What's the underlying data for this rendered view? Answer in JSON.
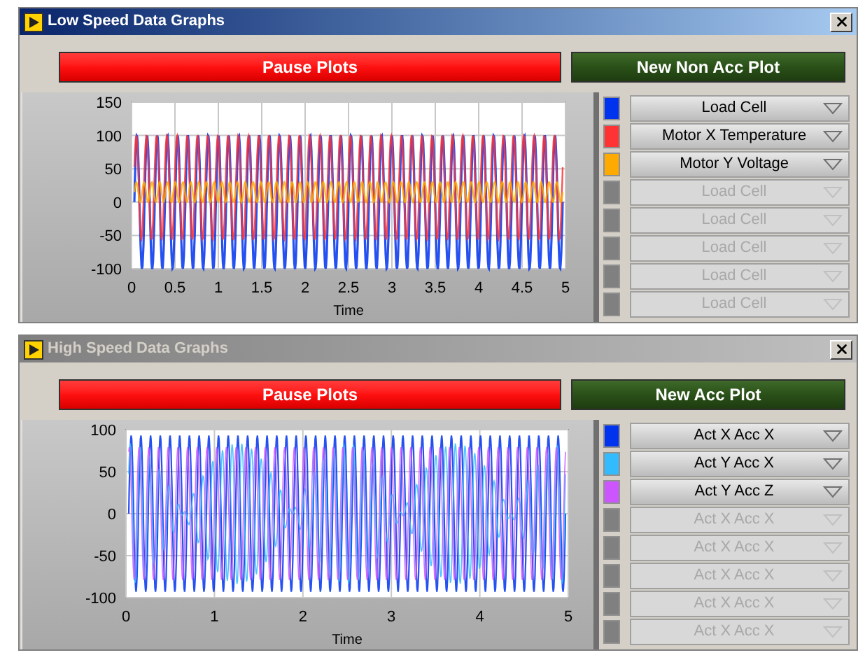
{
  "windows": [
    {
      "title": "Low Speed Data Graphs",
      "active": true,
      "buttons": [
        {
          "label": "Pause Plots",
          "kind": "pause"
        },
        {
          "label": "New Non Acc Plot",
          "kind": "new"
        }
      ],
      "graph": {
        "y_ticks": [
          "150",
          "100",
          "50",
          "0",
          "-50",
          "-100"
        ],
        "x_ticks": [
          "0",
          "0.5",
          "1",
          "1.5",
          "2",
          "2.5",
          "3",
          "3.5",
          "4",
          "4.5",
          "5"
        ],
        "x_label": "Time"
      },
      "plots": [
        {
          "label": "Load Cell",
          "color": "#0033ee",
          "disabled": false
        },
        {
          "label": "Motor X Temperature",
          "color": "#ff3333",
          "disabled": false
        },
        {
          "label": "Motor Y Voltage",
          "color": "#ffaa00",
          "disabled": false
        },
        {
          "label": "Load Cell",
          "color": "#808080",
          "disabled": true
        },
        {
          "label": "Load Cell",
          "color": "#808080",
          "disabled": true
        },
        {
          "label": "Load Cell",
          "color": "#808080",
          "disabled": true
        },
        {
          "label": "Load Cell",
          "color": "#808080",
          "disabled": true
        },
        {
          "label": "Load Cell",
          "color": "#808080",
          "disabled": true
        }
      ]
    },
    {
      "title": "High Speed Data Graphs",
      "active": false,
      "buttons": [
        {
          "label": "Pause Plots",
          "kind": "pause"
        },
        {
          "label": "New Acc Plot",
          "kind": "new"
        }
      ],
      "graph": {
        "y_ticks": [
          "100",
          "50",
          "0",
          "-50",
          "-100"
        ],
        "x_ticks": [
          "0",
          "1",
          "2",
          "3",
          "4",
          "5"
        ],
        "x_label": "Time"
      },
      "plots": [
        {
          "label": "Act X Acc X",
          "color": "#0033ee",
          "disabled": false
        },
        {
          "label": "Act Y Acc X",
          "color": "#33bbff",
          "disabled": false
        },
        {
          "label": "Act Y Acc Z",
          "color": "#cc55ff",
          "disabled": false
        },
        {
          "label": "Act X Acc X",
          "color": "#808080",
          "disabled": true
        },
        {
          "label": "Act X Acc X",
          "color": "#808080",
          "disabled": true
        },
        {
          "label": "Act X Acc X",
          "color": "#808080",
          "disabled": true
        },
        {
          "label": "Act X Acc X",
          "color": "#808080",
          "disabled": true
        },
        {
          "label": "Act X Acc X",
          "color": "#808080",
          "disabled": true
        }
      ]
    }
  ]
}
